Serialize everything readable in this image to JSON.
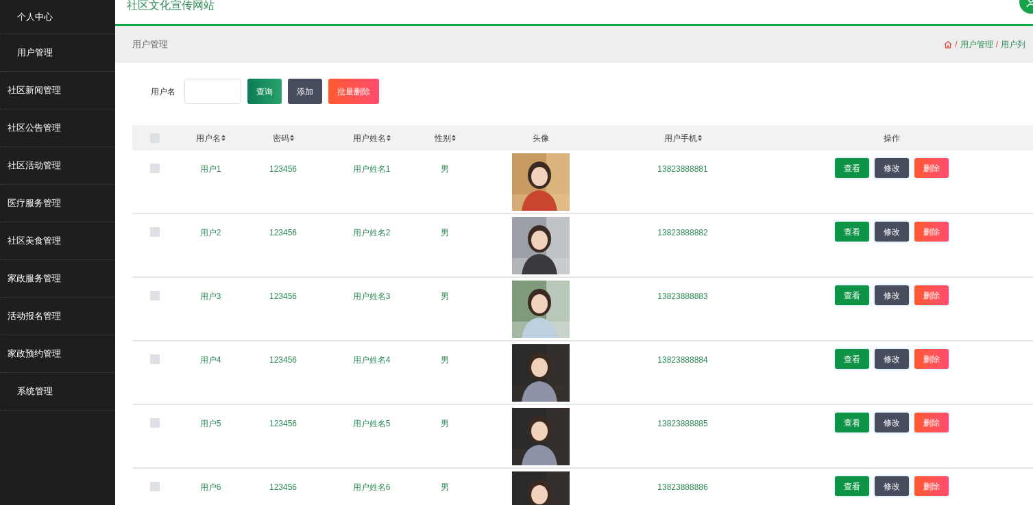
{
  "header": {
    "title": "社区文化宣传网站"
  },
  "sidebar": {
    "items": [
      {
        "label": "个人中心",
        "indented": true
      },
      {
        "label": "用户管理",
        "indented": true
      },
      {
        "label": "社区新闻管理",
        "indented": false
      },
      {
        "label": "社区公告管理",
        "indented": false
      },
      {
        "label": "社区活动管理",
        "indented": false
      },
      {
        "label": "医疗服务管理",
        "indented": false
      },
      {
        "label": "社区美食管理",
        "indented": false
      },
      {
        "label": "家政服务管理",
        "indented": false
      },
      {
        "label": "活动报名管理",
        "indented": false
      },
      {
        "label": "家政预约管理",
        "indented": false
      },
      {
        "label": "系统管理",
        "indented": true
      }
    ]
  },
  "breadcrumb_bar": {
    "title": "用户管理",
    "separator": "/",
    "trail": [
      "用户管理",
      "用户列"
    ]
  },
  "search": {
    "label": "用户名",
    "buttons": [
      {
        "label": "查询",
        "kind": "query"
      },
      {
        "label": "添加",
        "kind": "add"
      },
      {
        "label": "批量删除",
        "kind": "delete"
      }
    ]
  },
  "table": {
    "select_all": {
      "checked": false
    },
    "columns": [
      {
        "label": "用户名",
        "sortable": true
      },
      {
        "label": "密码",
        "sortable": true
      },
      {
        "label": "用户姓名",
        "sortable": true
      },
      {
        "label": "性别",
        "sortable": true
      },
      {
        "label": "头像",
        "sortable": false
      },
      {
        "label": "用户手机",
        "sortable": true
      },
      {
        "label": "操作",
        "sortable": false
      }
    ],
    "rows": [
      {
        "checked": false,
        "username": "用户1",
        "password": "123456",
        "name": "用户姓名1",
        "gender": "男",
        "phone": "13823888881",
        "actions": [
          "查看",
          "修改",
          "删除"
        ]
      },
      {
        "checked": false,
        "username": "用户2",
        "password": "123456",
        "name": "用户姓名2",
        "gender": "男",
        "phone": "13823888882",
        "actions": [
          "查看",
          "修改",
          "删除"
        ]
      },
      {
        "checked": false,
        "username": "用户3",
        "password": "123456",
        "name": "用户姓名3",
        "gender": "男",
        "phone": "13823888883",
        "actions": [
          "查看",
          "修改",
          "删除"
        ]
      },
      {
        "checked": false,
        "username": "用户4",
        "password": "123456",
        "name": "用户姓名4",
        "gender": "男",
        "phone": "13823888884",
        "actions": [
          "查看",
          "修改",
          "删除"
        ]
      },
      {
        "checked": false,
        "username": "用户5",
        "password": "123456",
        "name": "用户姓名5",
        "gender": "男",
        "phone": "13823888885",
        "actions": [
          "查看",
          "修改",
          "删除"
        ]
      },
      {
        "checked": false,
        "username": "用户6",
        "password": "123456",
        "name": "用户姓名6",
        "gender": "男",
        "phone": "13823888886",
        "actions": [
          "查看",
          "修改",
          "删除"
        ]
      }
    ]
  }
}
